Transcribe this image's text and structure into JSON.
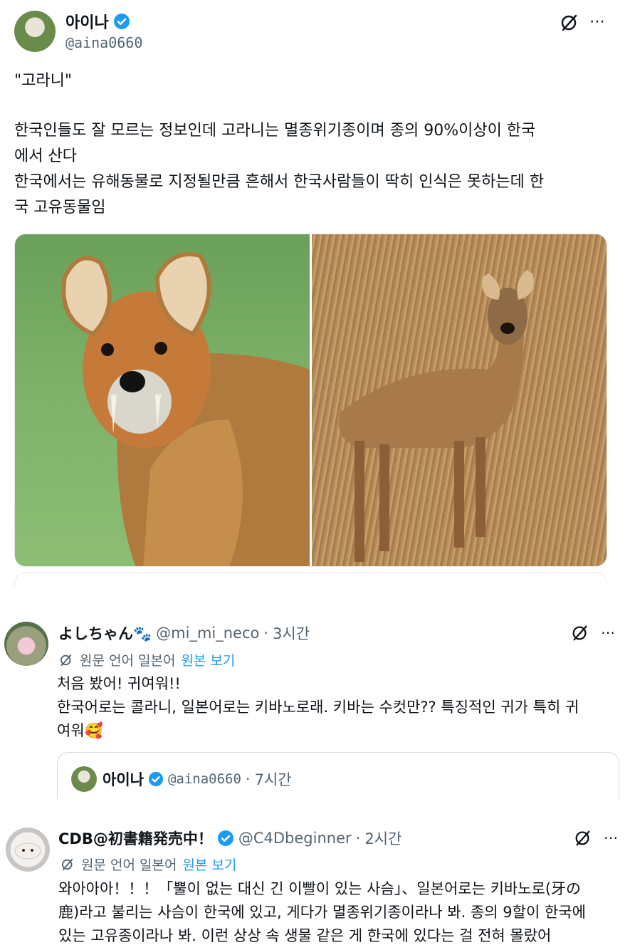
{
  "colors": {
    "verified": "#1d9bf0",
    "link": "#1d9bf0",
    "secondary": "#536471"
  },
  "main_tweet": {
    "display_name": "아이나",
    "handle": "@aina0660",
    "quote_line": "\"고라니\"",
    "body": "한국인들도 잘 모르는 정보인데 고라니는 멸종위기종이며 종의 90%이상이 한국\n에서 산다\n한국에서는 유해동물로 지정될만큼 흔해서 한국사람들이 딱히 인식은 못하는데 한\n국 고유동물임",
    "more_icon": "⋯"
  },
  "replies": [
    {
      "display_name": "よしちゃん🐾",
      "handle": "@mi_mi_neco",
      "separator": "·",
      "time": "3시간",
      "translate_label": "원문 언어 일본어",
      "view_original": "원본 보기",
      "text": "처음 봤어! 귀여워!!\n한국어로는 콜라니, 일본어로는 키바노로래. 키바는 수컷만?? 특징적인 귀가 특히 귀\n여워🥰",
      "quoted": {
        "display_name": "아이나",
        "handle": "@aina0660",
        "separator": "·",
        "time": "7시간"
      },
      "more_icon": "⋯"
    },
    {
      "display_name": "CDB@初書籍発売中！",
      "handle": "@C4Dbeginner",
      "separator": "·",
      "time": "2시간",
      "translate_label": "원문 언어 일본어",
      "view_original": "원본 보기",
      "text": "와아아아！！！「뿔이 없는 대신 긴 이빨이 있는 사슴」、일본어로는 키바노로(牙の\n鹿)라고 불리는 사슴이 한국에 있고, 게다가 멸종위기종이라나 봐. 종의 9할이 한국에\n있는 고유종이라나 봐. 이런 상상 속 생물 같은 게 한국에 있다는 걸 전혀 몰랐어",
      "more_icon": "⋯"
    }
  ]
}
